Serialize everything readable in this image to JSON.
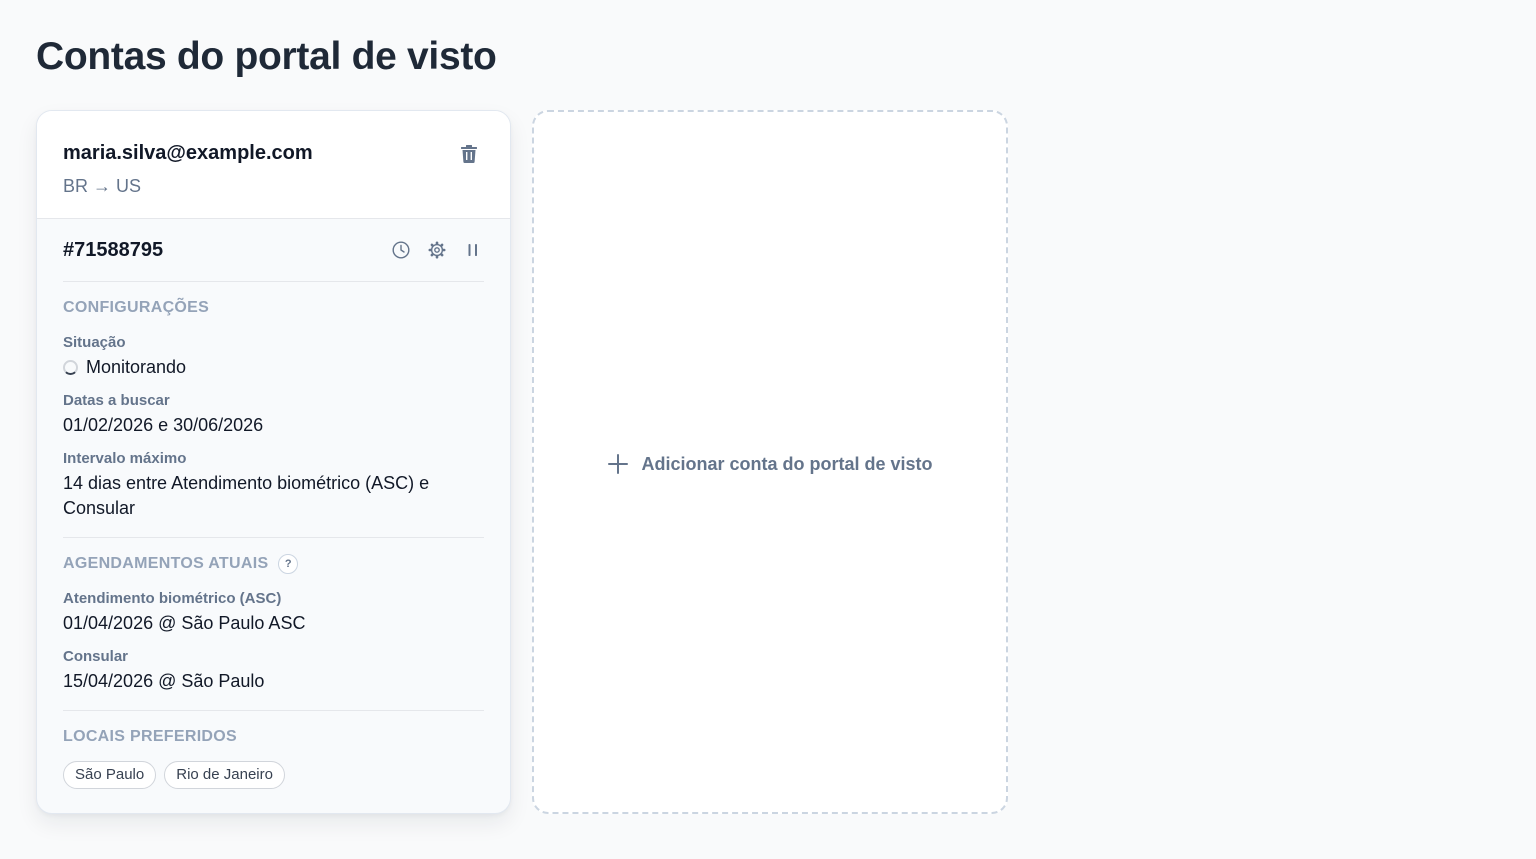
{
  "page": {
    "title": "Contas do portal de visto"
  },
  "account": {
    "email": "maria.silva@example.com",
    "route": "BR → US",
    "appointment_id": "#71588795",
    "configurations": {
      "title": "CONFIGURAÇÕES",
      "status_label": "Situação",
      "status_value": "Monitorando",
      "dates_label": "Datas a buscar",
      "dates_value": "01/02/2026 e 30/06/2026",
      "interval_label": "Intervalo máximo",
      "interval_value": "14 dias entre Atendimento biométrico (ASC) e Consular"
    },
    "current_appointments": {
      "title": "AGENDAMENTOS ATUAIS",
      "help": "?",
      "asc_label": "Atendimento biométrico (ASC)",
      "asc_value": "01/04/2026 @ São Paulo ASC",
      "consular_label": "Consular",
      "consular_value": "15/04/2026 @ São Paulo"
    },
    "preferred_locations": {
      "title": "LOCAIS PREFERIDOS",
      "items": [
        "São Paulo",
        "Rio de Janeiro"
      ]
    }
  },
  "add_account": {
    "label": "Adicionar conta do portal de visto"
  },
  "icons": {
    "delete": "trash-icon",
    "history": "clock-icon",
    "settings": "gear-icon",
    "pause": "pause-icon",
    "add": "plus-icon"
  },
  "colors": {
    "muted": "#64748b",
    "section": "#94a3b8",
    "text": "#111827",
    "border": "#e5e7eb"
  }
}
